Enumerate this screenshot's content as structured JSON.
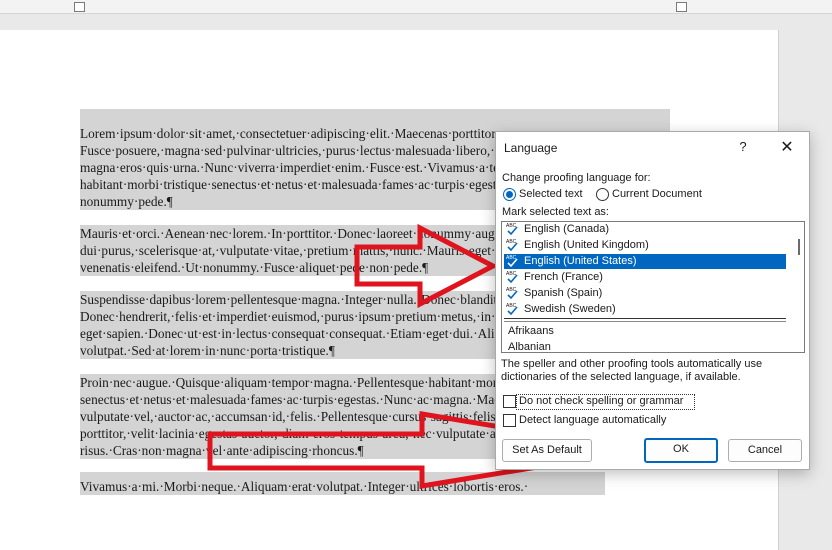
{
  "document": {
    "paragraphs": [
      [
        "Lorem·ipsum·dolor·sit·amet,·consectetuer·adipiscing·elit.·Maecenas·porttitor·congue·massa.·",
        "Fusce·posuere,·magna·sed·pulvinar·ultricies,·purus·lectus·malesuada·libero,·sit·amet·commodo·",
        "magna·eros·quis·urna.·Nunc·viverra·imperdiet·enim.·Fusce·est.·Vivamus·a·tellus.·Pellentesque·",
        "habitant·morbi·tristique·senectus·et·netus·et·malesuada·fames·ac·turpis·egestas.·Proin·pharetra·",
        "nonummy·pede.¶"
      ],
      [
        "Mauris·et·orci.·Aenean·nec·lorem.·In·porttitor.·Donec·laoreet·nonummy·augue.·Suspendisse·",
        "dui·purus,·scelerisque·at,·vulputate·vitae,·pretium·mattis,·nunc.·Mauris·eget·neque·at·sem·",
        "venenatis·eleifend.·Ut·nonummy.·Fusce·aliquet·pede·non·pede.¶"
      ],
      [
        "Suspendisse·dapibus·lorem·pellentesque·magna.·Integer·nulla.·Donec·blandit·feugiat·ligula.·",
        "Donec·hendrerit,·felis·et·imperdiet·euismod,·purus·ipsum·pretium·metus,·in·lacinia·nulla·nisl·",
        "eget·sapien.·Donec·ut·est·in·lectus·consequat·consequat.·Etiam·eget·dui.·Aliquam·erat·",
        "volutpat.·Sed·at·lorem·in·nunc·porta·tristique.¶"
      ],
      [
        "Proin·nec·augue.·Quisque·aliquam·tempor·magna.·Pellentesque·habitant·morbi·tristique·",
        "senectus·et·netus·et·malesuada·fames·ac·turpis·egestas.·Nunc·ac·magna.·Maecenas·odio·dolor,·",
        "vulputate·vel,·auctor·ac,·accumsan·id,·felis.·Pellentesque·cursus·sagittis·felis.·Pellentesque·",
        "porttitor,·velit·lacinia·egestas·auctor,·diam·eros·tempus·arcu,·nec·vulputate·augue·magna·vel·",
        "risus.·Cras·non·magna·vel·ante·adipiscing·rhoncus.¶"
      ]
    ],
    "last_line": "Vivamus·a·mi.·Morbi·neque.·Aliquam·erat·volutpat.·Integer·ultrices·lobortis·eros.·"
  },
  "dialog": {
    "title": "Language",
    "help_label": "?",
    "close_label": "✕",
    "change_label": "Change proofing language for:",
    "radio_selected_text": "Selected text",
    "radio_current_document": "Current Document",
    "mark_label": "Mark selected text as:",
    "languages_recent": [
      {
        "name": "English (Canada)",
        "selected": false
      },
      {
        "name": "English (United Kingdom)",
        "selected": false
      },
      {
        "name": "English (United States)",
        "selected": true
      },
      {
        "name": "French (France)",
        "selected": false
      },
      {
        "name": "Spanish (Spain)",
        "selected": false
      },
      {
        "name": "Swedish (Sweden)",
        "selected": false
      }
    ],
    "languages_other": [
      "Afrikaans",
      "Albanian"
    ],
    "description": "The speller and other proofing tools automatically use dictionaries of the selected language, if available.",
    "check_no_spelling": "Do not check spelling or grammar",
    "check_detect": "Detect language automatically",
    "set_default_label": "Set As Default",
    "ok_label": "OK",
    "cancel_label": "Cancel"
  },
  "colors": {
    "selection_highlight": "#d4d4d4",
    "list_selected": "#0067c0",
    "arrow_red": "#e0141e"
  }
}
